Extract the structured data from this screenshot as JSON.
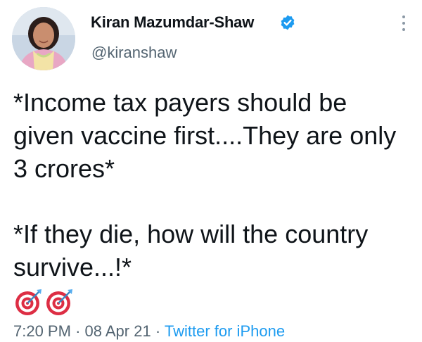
{
  "tweet": {
    "display_name": "Kiran Mazumdar-Shaw",
    "handle": "@kiranshaw",
    "verified_icon": "verified-badge-icon",
    "more_icon": "more-vertical-icon",
    "lines": [
      "*Income tax payers should be",
      "given vaccine first....They are only",
      "3 crores*",
      "*If they die, how will the country",
      "survive...!*"
    ],
    "emoji": [
      "direct-hit-icon",
      "direct-hit-icon"
    ],
    "time": "7:20 PM",
    "separator": "·",
    "date": "08 Apr 21",
    "source": "Twitter for iPhone",
    "colors": {
      "verified": "#1d9bf0",
      "secondary_text": "#536471",
      "link": "#1d9bf0"
    }
  }
}
